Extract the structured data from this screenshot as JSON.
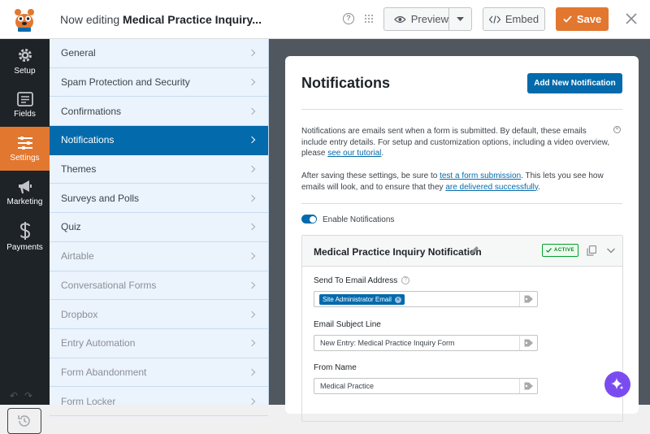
{
  "header": {
    "title_prefix": "Now editing ",
    "form_name": "Medical Practice Inquiry...",
    "help_icon": "?",
    "preview_label": "Preview",
    "embed_label": "Embed",
    "save_label": "Save"
  },
  "leftbar": {
    "items": [
      {
        "label": "Setup",
        "icon": "gear-icon"
      },
      {
        "label": "Fields",
        "icon": "fields-icon"
      },
      {
        "label": "Settings",
        "icon": "sliders-icon",
        "active": true
      },
      {
        "label": "Marketing",
        "icon": "megaphone-icon"
      },
      {
        "label": "Payments",
        "icon": "dollar-icon"
      }
    ]
  },
  "settings_panel": {
    "items": [
      {
        "label": "General",
        "state": "normal"
      },
      {
        "label": "Spam Protection and Security",
        "state": "normal"
      },
      {
        "label": "Confirmations",
        "state": "normal"
      },
      {
        "label": "Notifications",
        "state": "active"
      },
      {
        "label": "Themes",
        "state": "normal"
      },
      {
        "label": "Surveys and Polls",
        "state": "normal"
      },
      {
        "label": "Quiz",
        "state": "normal"
      },
      {
        "label": "Airtable",
        "state": "disabled"
      },
      {
        "label": "Conversational Forms",
        "state": "disabled"
      },
      {
        "label": "Dropbox",
        "state": "disabled"
      },
      {
        "label": "Entry Automation",
        "state": "disabled"
      },
      {
        "label": "Form Abandonment",
        "state": "disabled"
      },
      {
        "label": "Form Locker",
        "state": "disabled"
      }
    ]
  },
  "notifications": {
    "title": "Notifications",
    "add_button": "Add New Notification",
    "info_text": "Notifications are emails sent when a form is submitted. By default, these emails include entry details. For setup and customization options, including a video overview, please ",
    "info_link": "see our tutorial",
    "info_end": ".",
    "info2_a": "After saving these settings, be sure to ",
    "info2_link1": "test a form submission",
    "info2_b": ". This lets you see how emails will look, and to ensure that they ",
    "info2_link2": "are delivered successfully",
    "info2_c": ".",
    "enable_label": "Enable Notifications",
    "enabled": true,
    "notification_name": "Medical Practice Inquiry Notification",
    "status_badge": "ACTIVE",
    "send_to_label": "Send To Email Address",
    "send_to_chip": "Site Administrator Email",
    "subject_label": "Email Subject Line",
    "subject_value": "New Entry: Medical Practice Inquiry Form",
    "from_name_label": "From Name",
    "from_name_value": "Medical Practice"
  },
  "colors": {
    "accent_orange": "#e27730",
    "primary_blue": "#036aab",
    "sidebar_dark": "#1d2327",
    "ai_button": "#7a4cf0"
  }
}
